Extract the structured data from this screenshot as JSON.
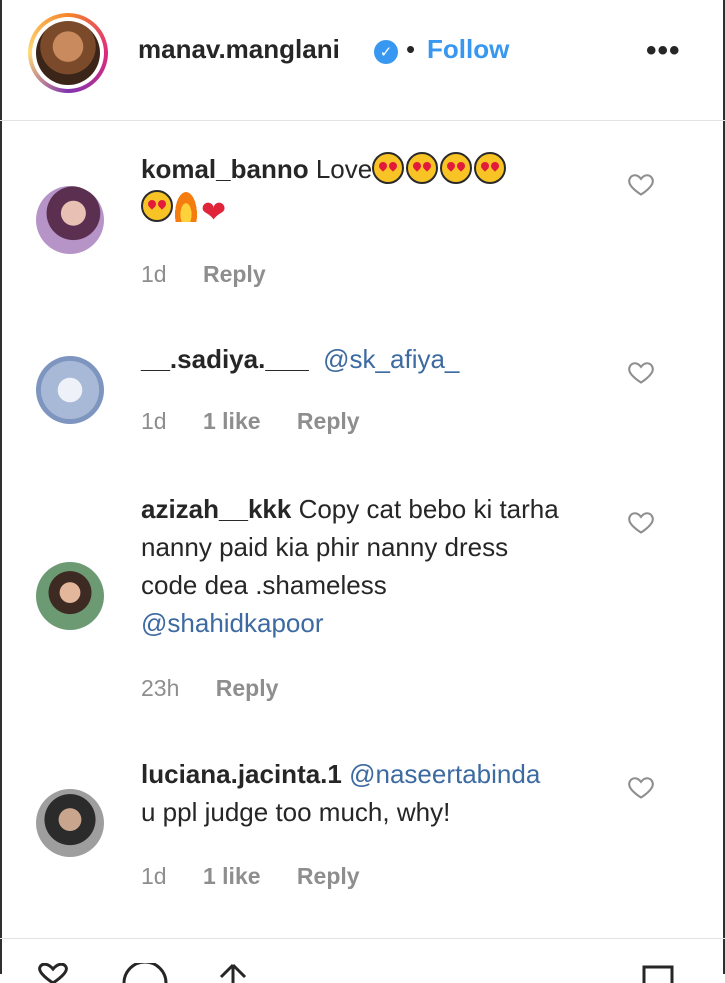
{
  "header": {
    "username": "manav.manglani",
    "verified_icon": "verified-badge-icon",
    "separator": "•",
    "follow_label": "Follow",
    "more_label": "•••"
  },
  "comments": [
    {
      "username": "komal_banno",
      "text": "Love",
      "emojis": [
        "star-struck",
        "star-struck",
        "star-struck",
        "star-struck",
        "star-struck",
        "fire",
        "red-heart"
      ],
      "time": "1d",
      "likes": "",
      "reply_label": "Reply"
    },
    {
      "username": "__.sadiya.___",
      "mention": "@sk_afiya_",
      "text": "",
      "time": "1d",
      "likes": "1 like",
      "reply_label": "Reply"
    },
    {
      "username": "azizah__kkk",
      "text": "Copy cat bebo ki tarha nanny paid kia phir nanny dress code dea .shameless",
      "mention": "@shahidkapoor",
      "time": "23h",
      "likes": "",
      "reply_label": "Reply"
    },
    {
      "username": "luciana.jacinta.1",
      "mention": "@naseertabinda",
      "text": "u ppl judge too much, why!",
      "time": "1d",
      "likes": "1 like",
      "reply_label": "Reply"
    }
  ],
  "colors": {
    "accent_blue": "#3897f0",
    "mention_blue": "#3d6aa0",
    "meta_gray": "#8e8e8e",
    "text": "#262626"
  }
}
